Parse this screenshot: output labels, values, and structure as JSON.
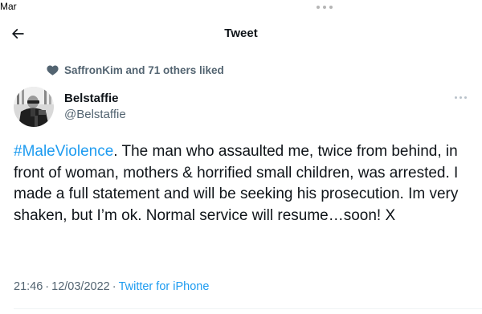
{
  "status_bar": {
    "carrier": "Mar"
  },
  "header": {
    "title": "Tweet",
    "back_icon": "arrow-left-icon"
  },
  "social_context": {
    "icon": "heart-icon",
    "text": "SaffronKim and 71 others liked"
  },
  "tweet": {
    "author": {
      "name": "Belstaffie",
      "handle": "@Belstaffie"
    },
    "hashtag": "#MaleViolence",
    "text": ". The man who assaulted me, twice from behind, in front of woman, mothers & horrified small children, was arrested. I made a full statement and will be seeking his prosecution. Im very shaken, but I’m ok. Normal service will resume…soon! X",
    "time": "21:46",
    "date": "12/03/2022",
    "separator": "·",
    "source": "Twitter for iPhone"
  },
  "colors": {
    "link": "#1d9bf0",
    "secondary_text": "#536471",
    "primary_text": "#0f1419"
  }
}
